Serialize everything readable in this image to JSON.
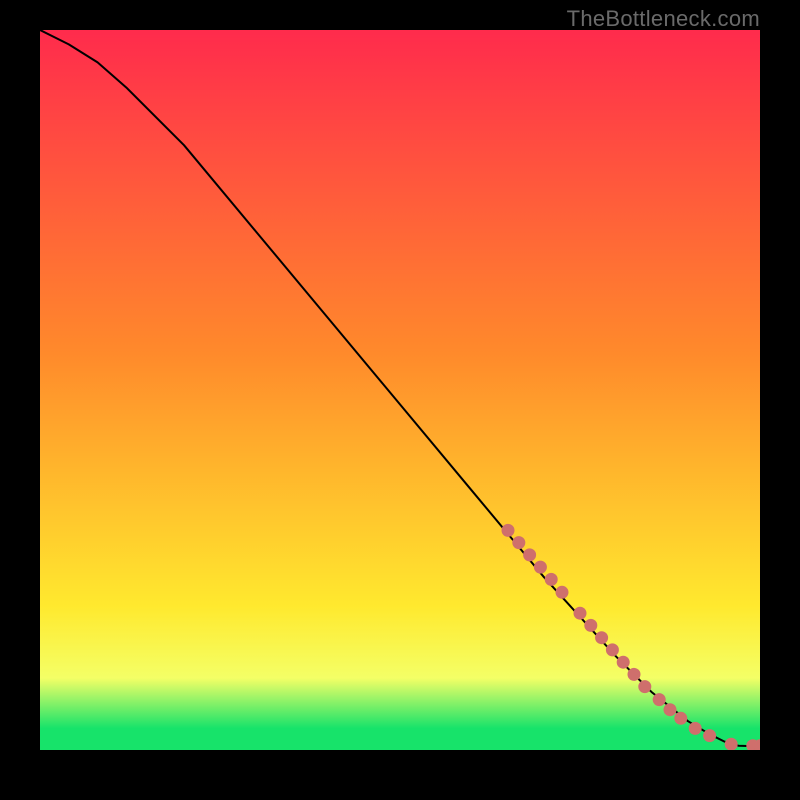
{
  "watermark": "TheBottleneck.com",
  "colors": {
    "bg_black": "#000000",
    "line": "#000000",
    "marker": "#cf6f6c",
    "green": "#17e36a",
    "yellow": "#ffe92e",
    "orange": "#ff8a2b",
    "red": "#ff2b4c"
  },
  "chart_data": {
    "type": "line",
    "title": "",
    "xlabel": "",
    "ylabel": "",
    "xlim": [
      0,
      100
    ],
    "ylim": [
      0,
      100
    ],
    "gradient_bands": [
      {
        "y0": 0,
        "y1": 3,
        "from": "#17e36a",
        "to": "#17e36a"
      },
      {
        "y0": 3,
        "y1": 10,
        "from": "#17e36a",
        "to": "#f4ff66"
      },
      {
        "y0": 10,
        "y1": 20,
        "from": "#f4ff66",
        "to": "#ffe92e"
      },
      {
        "y0": 20,
        "y1": 55,
        "from": "#ffe92e",
        "to": "#ff8a2b"
      },
      {
        "y0": 55,
        "y1": 100,
        "from": "#ff8a2b",
        "to": "#ff2b4c"
      }
    ],
    "series": [
      {
        "name": "curve",
        "x": [
          0,
          4,
          8,
          12,
          20,
          30,
          40,
          50,
          60,
          70,
          80,
          85,
          90,
          93,
          95,
          97,
          100
        ],
        "y": [
          100,
          98,
          95.5,
          92,
          84,
          72,
          60,
          48,
          36,
          24,
          13,
          8,
          4,
          2.2,
          1.2,
          0.6,
          0.5
        ]
      }
    ],
    "markers": [
      {
        "x": 65,
        "y": 30.5
      },
      {
        "x": 66.5,
        "y": 28.8
      },
      {
        "x": 68,
        "y": 27.1
      },
      {
        "x": 69.5,
        "y": 25.4
      },
      {
        "x": 71,
        "y": 23.7
      },
      {
        "x": 72.5,
        "y": 21.9
      },
      {
        "x": 75,
        "y": 19.0
      },
      {
        "x": 76.5,
        "y": 17.3
      },
      {
        "x": 78,
        "y": 15.6
      },
      {
        "x": 79.5,
        "y": 13.9
      },
      {
        "x": 81,
        "y": 12.2
      },
      {
        "x": 82.5,
        "y": 10.5
      },
      {
        "x": 84,
        "y": 8.8
      },
      {
        "x": 86,
        "y": 7.0
      },
      {
        "x": 87.5,
        "y": 5.6
      },
      {
        "x": 89,
        "y": 4.4
      },
      {
        "x": 91,
        "y": 3.0
      },
      {
        "x": 93,
        "y": 2.0
      },
      {
        "x": 96,
        "y": 0.8
      },
      {
        "x": 99,
        "y": 0.6
      },
      {
        "x": 100,
        "y": 0.6
      }
    ]
  }
}
